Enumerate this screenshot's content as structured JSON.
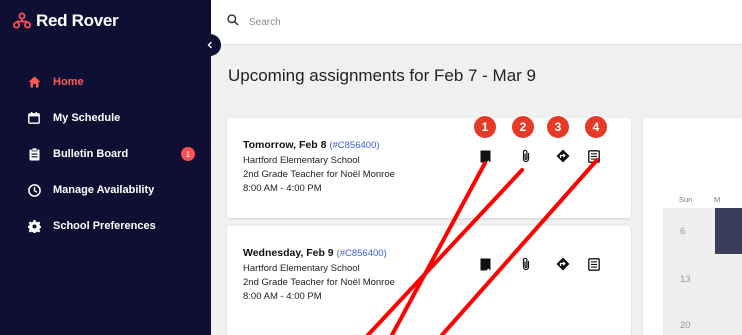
{
  "app": {
    "name": "Red Rover"
  },
  "sidebar": {
    "items": [
      {
        "label": "Home",
        "icon": "home-icon",
        "active": true
      },
      {
        "label": "My Schedule",
        "icon": "calendar-icon"
      },
      {
        "label": "Bulletin Board",
        "icon": "clipboard-icon",
        "badge": "1"
      },
      {
        "label": "Manage Availability",
        "icon": "clock-icon"
      },
      {
        "label": "School Preferences",
        "icon": "gear-icon"
      }
    ]
  },
  "search": {
    "placeholder": "Search"
  },
  "page": {
    "title": "Upcoming assignments for Feb 7 - Mar 9"
  },
  "assignments": [
    {
      "date": "Tomorrow, Feb 8",
      "conf": "(#C856400)",
      "school": "Hartford Elementary School",
      "position": "2nd Grade Teacher for Noël Monroe",
      "time": "8:00 AM - 4:00 PM"
    },
    {
      "date": "Wednesday, Feb 9",
      "conf": "(#C856400)",
      "school": "Hartford Elementary School",
      "position": "2nd Grade Teacher for Noël Monroe",
      "time": "8:00 AM - 4:00 PM"
    }
  ],
  "callouts": [
    "1",
    "2",
    "3",
    "4"
  ],
  "calendar": {
    "weekday_sun": "Sun",
    "weekday_next": "M",
    "days": [
      "6",
      "13",
      "20"
    ]
  },
  "colors": {
    "sidebar_bg": "#0e0f33",
    "accent": "#ff5a55",
    "badge": "#ff4d57",
    "link": "#3b5bdb",
    "callout": "#e53a26",
    "annotation_line": "#ff0000"
  }
}
